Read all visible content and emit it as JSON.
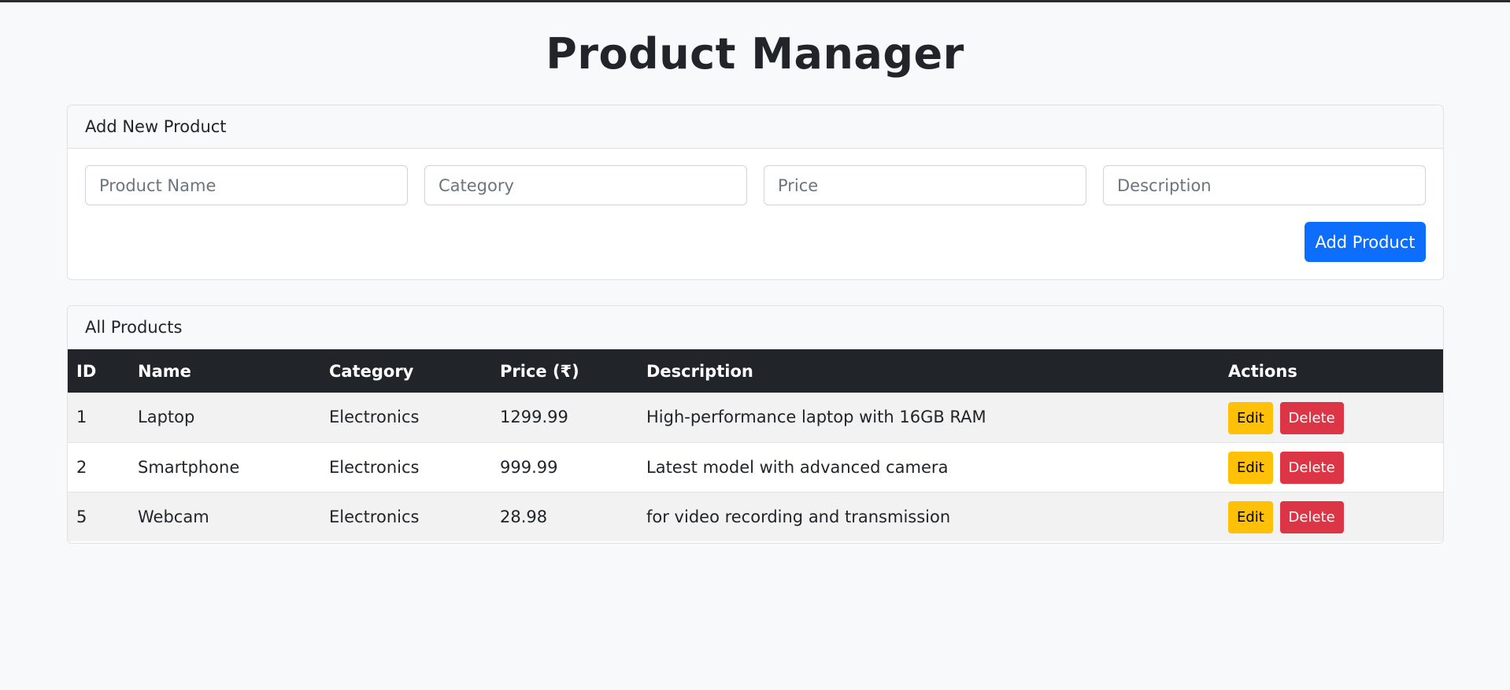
{
  "page": {
    "title": "Product Manager"
  },
  "add_form": {
    "header": "Add New Product",
    "fields": {
      "name_placeholder": "Product Name",
      "category_placeholder": "Category",
      "price_placeholder": "Price",
      "description_placeholder": "Description"
    },
    "submit_label": "Add Product"
  },
  "product_list": {
    "header": "All Products",
    "columns": {
      "id": "ID",
      "name": "Name",
      "category": "Category",
      "price": "Price (₹)",
      "description": "Description",
      "actions": "Actions"
    },
    "rows": [
      {
        "id": "1",
        "name": "Laptop",
        "category": "Electronics",
        "price": "1299.99",
        "description": "High-performance laptop with 16GB RAM",
        "edit_label": "Edit",
        "delete_label": "Delete"
      },
      {
        "id": "2",
        "name": "Smartphone",
        "category": "Electronics",
        "price": "999.99",
        "description": "Latest model with advanced camera",
        "edit_label": "Edit",
        "delete_label": "Delete"
      },
      {
        "id": "5",
        "name": "Webcam",
        "category": "Electronics",
        "price": "28.98",
        "description": "for video recording and transmission",
        "edit_label": "Edit",
        "delete_label": "Delete"
      }
    ]
  },
  "colors": {
    "primary": "#0d6efd",
    "warning": "#ffc107",
    "danger": "#dc3545",
    "table_header": "#212529"
  }
}
